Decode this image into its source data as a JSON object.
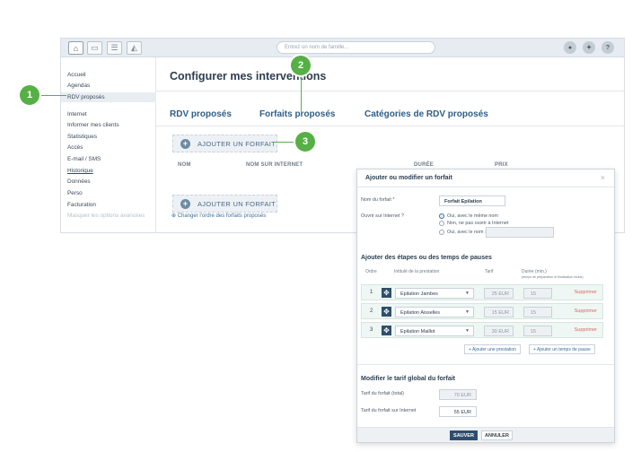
{
  "topbar": {
    "search_placeholder": "Entrez un nom de famille...",
    "help_label": "?"
  },
  "sidebar": {
    "items": [
      {
        "label": "Accueil"
      },
      {
        "label": "Agendas"
      },
      {
        "label": "RDV proposés"
      },
      {
        "label": "Internet"
      },
      {
        "label": "Informer mes clients"
      },
      {
        "label": "Statistiques"
      },
      {
        "label": "Accès"
      },
      {
        "label": "E-mail / SMS"
      },
      {
        "label": "Historique"
      },
      {
        "label": "Données"
      },
      {
        "label": "Perso"
      },
      {
        "label": "Facturation"
      },
      {
        "label": "Masquer les options avancées"
      }
    ]
  },
  "main": {
    "title": "Configurer mes interventions",
    "tabs": [
      {
        "label": "RDV proposés"
      },
      {
        "label": "Forfaits proposés"
      },
      {
        "label": "Catégories de RDV proposés"
      }
    ],
    "add_button_label": "AJOUTER UN FORFAIT",
    "columns": [
      "NOM",
      "NOM SUR INTERNET",
      "DURÉE",
      "PRIX"
    ],
    "reorder_link": "Changer l'ordre des forfaits proposés"
  },
  "badges": [
    "1",
    "2",
    "3"
  ],
  "dialog": {
    "title": "Ajouter ou modifier un forfait",
    "close": "×",
    "name_label": "Nom du forfait *",
    "name_value": "Forfait Epilation",
    "internet_label": "Ouvrir sur Internet ?",
    "radio_options": [
      "Oui, avec le même nom",
      "Non, ne pas ouvrir à Internet",
      "Oui, avec le nom :"
    ],
    "steps_title": "Ajouter des étapes ou des temps de pauses",
    "table_headers": {
      "order": "Ordre",
      "label": "Intitulé de la prestation",
      "price": "Tarif",
      "duration": "Durée (min.)",
      "duration_note": "(temps de préparation et finalisation inclus)"
    },
    "rows": [
      {
        "order": "1",
        "service": "Epilation Jambes",
        "price": "25 EUR",
        "duration": "15",
        "delete": "Supprimer"
      },
      {
        "order": "2",
        "service": "Epilation Aisselles",
        "price": "15 EUR",
        "duration": "15",
        "delete": "Supprimer"
      },
      {
        "order": "3",
        "service": "Epilation Maillot",
        "price": "30 EUR",
        "duration": "15",
        "delete": "Supprimer"
      }
    ],
    "add_service_link": "+ Ajouter une prestation",
    "add_pause_link": "+ Ajouter un temps de pause",
    "tarif_title": "Modifier le tarif global du forfait",
    "total_label": "Tarif du forfait (total)",
    "total_value": "70 EUR",
    "internet_price_label": "Tarif du forfait sur Internet",
    "internet_price_value": "55 EUR",
    "save_label": "SAUVER",
    "cancel_label": "ANNULER"
  },
  "colors": {
    "accent_green": "#56b045",
    "tab_blue": "#2f5e86",
    "save_button": "#2f4e6b",
    "delete_red": "#e0655a"
  },
  "icons": [
    "home-icon",
    "calendar-icon",
    "list-icon",
    "chart-icon",
    "user-icon",
    "team-icon",
    "help-icon",
    "plus-icon",
    "drag-handle-icon",
    "caret-down-icon",
    "close-icon"
  ]
}
